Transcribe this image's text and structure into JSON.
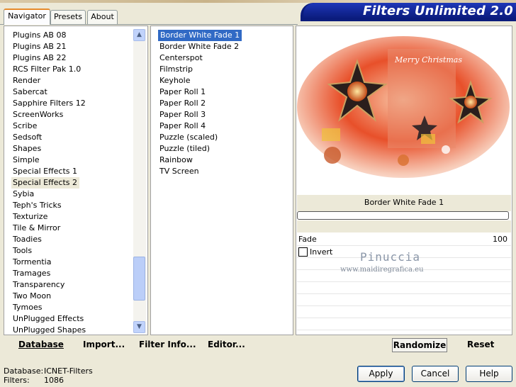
{
  "window": {
    "title": "Filters Unlimited 2.0"
  },
  "tabs": [
    {
      "label": "Navigator",
      "active": true
    },
    {
      "label": "Presets",
      "active": false
    },
    {
      "label": "About",
      "active": false
    }
  ],
  "categories": {
    "items": [
      "Plugins AB 08",
      "Plugins AB 21",
      "Plugins AB 22",
      "RCS Filter Pak 1.0",
      "Render",
      "Sabercat",
      "Sapphire Filters 12",
      "ScreenWorks",
      "Scribe",
      "Sedsoft",
      "Shapes",
      "Simple",
      "Special Effects 1",
      "Special Effects 2",
      "Sybia",
      "Teph's Tricks",
      "Texturize",
      "Tile & Mirror",
      "Toadies",
      "Tools",
      "Tormentia",
      "Tramages",
      "Transparency",
      "Two Moon",
      "Tymoes",
      "UnPlugged Effects",
      "UnPlugged Shapes"
    ],
    "selected": "Special Effects 2"
  },
  "filters": {
    "items": [
      "Border White Fade 1",
      "Border White Fade 2",
      "Centerspot",
      "Filmstrip",
      "Keyhole",
      "Paper Roll 1",
      "Paper Roll 2",
      "Paper Roll 3",
      "Paper Roll 4",
      "Puzzle (scaled)",
      "Puzzle (tiled)",
      "Rainbow",
      "TV Screen"
    ],
    "selected": "Border White Fade 1"
  },
  "preview": {
    "filter_name": "Border White Fade 1",
    "progress": 0,
    "image_text": "Merry Christmas"
  },
  "params": {
    "fade_label": "Fade",
    "fade_value": "100",
    "invert_label": "Invert",
    "invert_checked": false
  },
  "watermark": {
    "line1": "Pinuccia",
    "line2": "www.maidiregrafica.eu"
  },
  "toolbar": {
    "database_label": "Database",
    "import_label": "Import...",
    "filter_info_label": "Filter Info...",
    "editor_label": "Editor...",
    "randomize_label": "Randomize",
    "reset_label": "Reset"
  },
  "status": {
    "database_key": "Database:",
    "database_value": "ICNET-Filters",
    "filters_key": "Filters:",
    "filters_value": "1086"
  },
  "buttons": {
    "apply": "Apply",
    "cancel": "Cancel",
    "help": "Help"
  },
  "colors": {
    "selection": "#316AC5",
    "banner": "#0B1C7C",
    "tab_accent": "#E68B2C"
  }
}
